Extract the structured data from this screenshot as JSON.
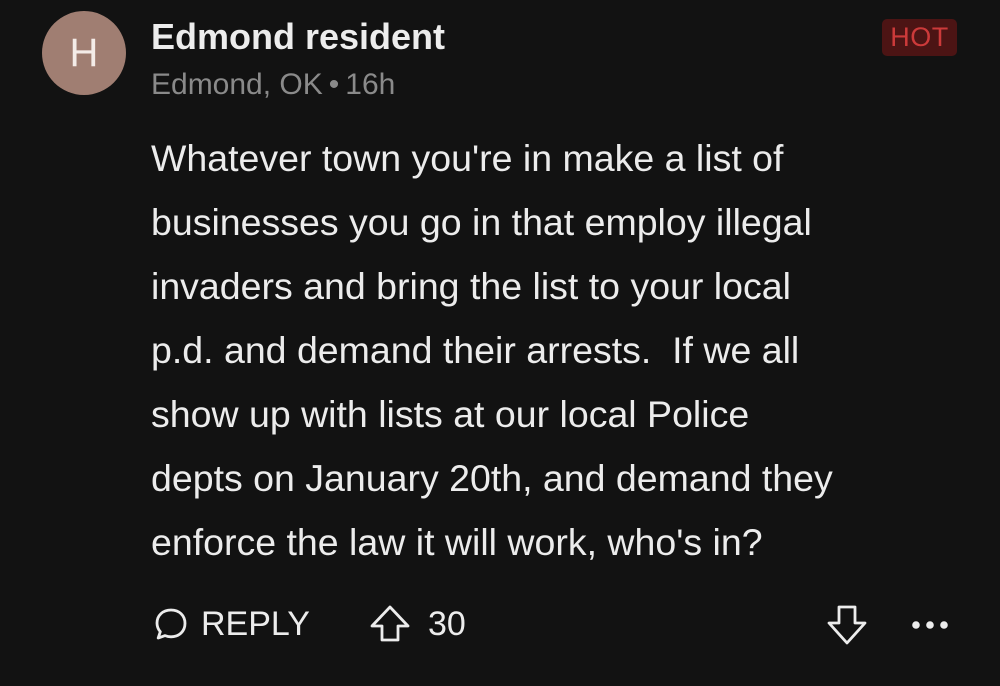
{
  "comment": {
    "avatar_initial": "H",
    "author": "Edmond resident",
    "location": "Edmond, OK",
    "separator": "•",
    "time_ago": "16h",
    "badge": "HOT",
    "body_lines": [
      "Whatever town you're in make a list of",
      "businesses you go in that employ illegal",
      "invaders and bring the list to your local",
      "p.d. and demand their arrests.  If we all",
      "show up with lists at our local Police",
      "depts on January 20th, and demand they",
      "enforce the law it will work, who's in?"
    ]
  },
  "actions": {
    "reply_label": "REPLY",
    "upvote_count": "30",
    "reply_icon": "speech-bubble-icon",
    "upvote_icon": "arrow-up-icon",
    "downvote_icon": "arrow-down-icon",
    "more_icon": "ellipsis-icon"
  },
  "colors": {
    "background": "#121212",
    "avatar": "#a07e72",
    "badge_bg": "#4c1414",
    "badge_text": "#cc3a3a",
    "meta_text": "#8a8a8a"
  }
}
